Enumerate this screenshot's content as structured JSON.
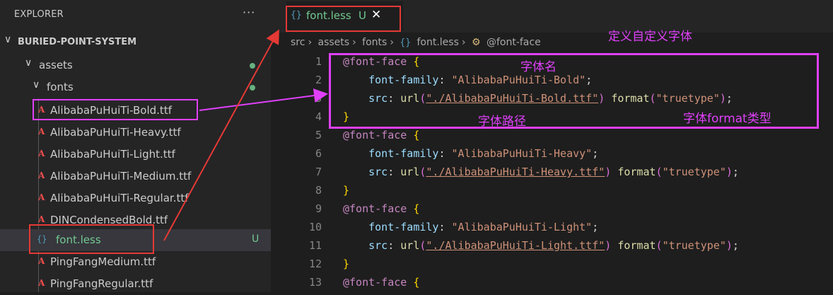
{
  "explorer": {
    "title": "EXPLORER",
    "more_icon": "···",
    "root": "BURIED-POINT-SYSTEM",
    "folders": {
      "assets": "assets",
      "fonts": "fonts"
    },
    "files": [
      {
        "name": "AlibabaPuHuiTi-Bold.ttf",
        "icon": "ttf-icon"
      },
      {
        "name": "AlibabaPuHuiTi-Heavy.ttf",
        "icon": "ttf-icon"
      },
      {
        "name": "AlibabaPuHuiTi-Light.ttf",
        "icon": "ttf-icon"
      },
      {
        "name": "AlibabaPuHuiTi-Medium.ttf",
        "icon": "ttf-icon"
      },
      {
        "name": "AlibabaPuHuiTi-Regular.ttf",
        "icon": "ttf-icon"
      },
      {
        "name": "DINCondensedBold.ttf",
        "icon": "ttf-icon"
      },
      {
        "name": "font.less",
        "icon": "less-icon",
        "badge": "U"
      },
      {
        "name": "PingFangMedium.ttf",
        "icon": "ttf-icon"
      },
      {
        "name": "PingFangRegular.ttf",
        "icon": "ttf-icon"
      }
    ]
  },
  "tab": {
    "label": "font.less",
    "status": "U",
    "close": "✕",
    "icon": "{}"
  },
  "breadcrumb": [
    "src",
    "assets",
    "fonts",
    "font.less",
    "@font-face"
  ],
  "code_lines": [
    {
      "n": "1",
      "text": "@font-face {"
    },
    {
      "n": "2",
      "text": "    font-family: \"AlibabaPuHuiTi-Bold\";"
    },
    {
      "n": "3",
      "text": "    src: url(\"./AlibabaPuHuiTi-Bold.ttf\") format(\"truetype\");"
    },
    {
      "n": "4",
      "text": "}"
    },
    {
      "n": "5",
      "text": "@font-face {"
    },
    {
      "n": "6",
      "text": "    font-family: \"AlibabaPuHuiTi-Heavy\";"
    },
    {
      "n": "7",
      "text": "    src: url(\"./AlibabaPuHuiTi-Heavy.ttf\") format(\"truetype\");"
    },
    {
      "n": "8",
      "text": "}"
    },
    {
      "n": "9",
      "text": "@font-face {"
    },
    {
      "n": "10",
      "text": "    font-family: \"AlibabaPuHuiTi-Light\";"
    },
    {
      "n": "11",
      "text": "    src: url(\"./AlibabaPuHuiTi-Light.ttf\") format(\"truetype\");"
    },
    {
      "n": "12",
      "text": "}"
    },
    {
      "n": "13",
      "text": "@font-face {"
    }
  ],
  "annotations": {
    "define_font": "定义自定义字体",
    "font_name": "字体名",
    "font_path": "字体路径",
    "font_format": "字体format类型"
  },
  "colors": {
    "annotation": "#e040fb",
    "highlight_box": "#e53935",
    "git_untracked": "#73c991"
  }
}
